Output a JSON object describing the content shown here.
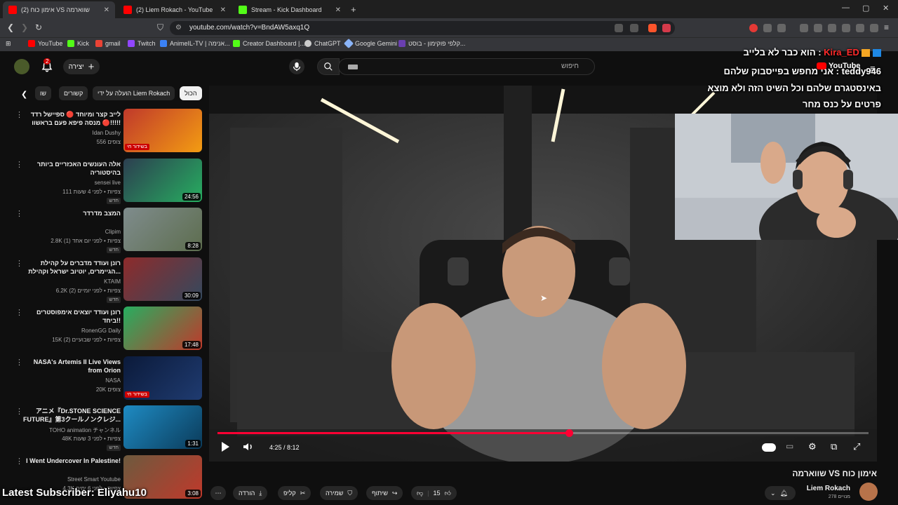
{
  "browser": {
    "tabs": [
      {
        "label": "(2) אימון כוח VS שווארמה",
        "active": true
      },
      {
        "label": "(2) Liem Rokach - YouTube",
        "active": false
      },
      {
        "label": "Stream - Kick Dashboard",
        "active": false
      }
    ],
    "url": "youtube.com/watch?v=BndAW5axq1Q",
    "bookmarks": [
      "YouTube",
      "Kick",
      "gmail",
      "Twitch",
      "AnimeIL-TV | אנימה...",
      "Creator Dashboard |...",
      "ChatGPT",
      "Google Gemini",
      "קלפי פוקימון - בוסט..."
    ]
  },
  "youtube": {
    "create_label": "יצירה",
    "notification_count": "2",
    "search_placeholder": "חיפוש",
    "chips": [
      "הכול",
      "הועלה על ידי Liem Rokach",
      "קשורים",
      "שו"
    ],
    "recommendations": [
      {
        "title": "לייב קצר ומיוחד 🔴 ספיישל רדד 🔴 מנסה פיפא פעם בראשוו!!!!!",
        "channel": "Idan Dushy",
        "meta": "556 צופים",
        "badge": "בשידור חי",
        "duration": ""
      },
      {
        "title": "אלה העונשים האכזריים ביותר בהיסטוריה",
        "channel": "sensei live",
        "meta": "111 צפיות • לפני 4 שעות",
        "badge": "",
        "duration": "24:56",
        "new": "חדש"
      },
      {
        "title": "המצב מדרדר",
        "channel": "Clipim",
        "meta": "2.8K צפיות • לפני יום אחד (1)",
        "badge": "",
        "duration": "8:28",
        "new": "חדש"
      },
      {
        "title": "רונן ועודד מדברים על קהילת הגיימרים, יוטיוב ישראל וקהילת...",
        "channel": "KTAIM",
        "meta": "6.2K צפיות • לפני יומיים (2)",
        "badge": "",
        "duration": "30:09",
        "new": "חדש"
      },
      {
        "title": "רונן ועודד יוצאים אימפוסטרים ביחד!!",
        "channel": "RonenGG Daily",
        "meta": "15K צפיות • לפני שבועיים (2)",
        "badge": "",
        "duration": "17:48",
        "new": ""
      },
      {
        "title": "NASA's Artemis II Live Views from Orion",
        "channel": "NASA",
        "meta": "20K צופים",
        "badge": "בשידור חי",
        "duration": ""
      },
      {
        "title": "アニメ『Dr.STONE SCIENCE FUTURE』第3クールノンクレジ...",
        "channel": "TOHO animation チャンネル",
        "meta": "48K צפיות • לפני 3 שעות",
        "badge": "",
        "duration": "1:31",
        "new": "חדש"
      },
      {
        "title": "I Went Undercover In Palestine!",
        "channel": "Street Smart Youtube",
        "meta": "4.3K צפיות • לפני 6 ימים",
        "badge": "",
        "duration": "3:08",
        "new": ""
      }
    ],
    "player": {
      "current_time": "4:25",
      "duration": "8:12",
      "time_display": "4:25 / 8:12",
      "progress": 0.54
    },
    "video_title": "שווארמה VS אימון כוח",
    "channel_name": "Liem Rokach",
    "subscribers": "278 מנויים",
    "actions": {
      "likes": "15",
      "share": "שיתוף",
      "save": "שמירה",
      "clip": "קליפ",
      "download": "הורדה"
    }
  },
  "stream_overlay": {
    "chat": [
      {
        "user": "Kira_ED",
        "text": "הוא כבר לא בלייב"
      },
      {
        "user": "teddy946",
        "text": "אני מחפש בפייסבוק שלהם"
      },
      {
        "user": "",
        "text": "באינסטגרם שלהם וכל השיט הזה ולא מוצא"
      },
      {
        "user": "",
        "text": "פרטים על כנס מחר"
      }
    ],
    "youtube_badge": "YouTube",
    "latest_subscriber": "Latest Subscriber: Eliyahu10"
  },
  "colors": {
    "accent": "#ff0033",
    "bg": "#0f0f0f",
    "chip": "#272727",
    "chat_user": "#ff2a2a"
  }
}
